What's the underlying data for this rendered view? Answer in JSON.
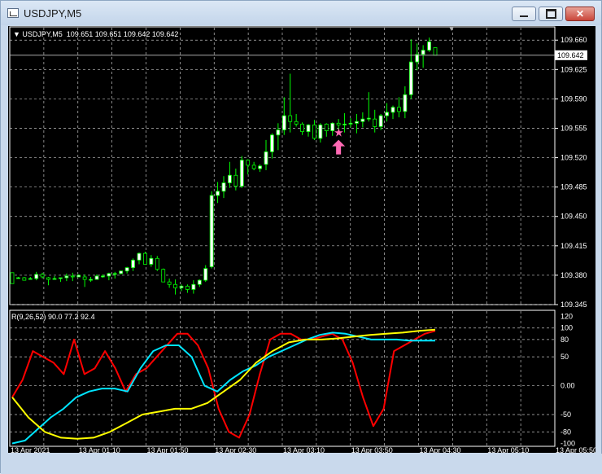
{
  "window": {
    "title": "USDJPY,M5",
    "minimize_icon": "minimize-icon",
    "maximize_icon": "maximize-icon",
    "close_icon": "close-icon"
  },
  "chart": {
    "symbol_header": "USDJPY,M5  109.651 109.651 109.642 109.642",
    "current_price": "109.642",
    "price_ticks": [
      "109.660",
      "109.625",
      "109.590",
      "109.555",
      "109.520",
      "109.485",
      "109.450",
      "109.415",
      "109.380",
      "109.345"
    ],
    "indicator_header": "R(9,26,52) 90.0 77.2 92.4",
    "indicator_ticks": [
      "120",
      "100",
      "80",
      "50",
      "0.00",
      "-50",
      "-80",
      "-100"
    ],
    "time_ticks": [
      "13 Apr 2021",
      "13 Apr 01:10",
      "13 Apr 01:50",
      "13 Apr 02:30",
      "13 Apr 03:10",
      "13 Apr 03:50",
      "13 Apr 04:30",
      "13 Apr 05:10",
      "13 Apr 05:50"
    ],
    "colors": {
      "background": "#000000",
      "grid": "#c0c0c0",
      "candle": "#00ff00",
      "body_fill": "#ffffff",
      "rsi_fast": "#ff0000",
      "rsi_mid": "#00e5ff",
      "rsi_slow": "#ffff00",
      "arrow": "#ff69b4"
    }
  },
  "chart_data": [
    {
      "type": "candlestick",
      "title": "USDJPY,M5",
      "ylim": [
        109.345,
        109.668
      ],
      "ohlc": [
        [
          109.383,
          109.383,
          109.37,
          109.37
        ],
        [
          109.377,
          109.378,
          109.376,
          109.377
        ],
        [
          109.377,
          109.378,
          109.374,
          109.374
        ],
        [
          109.376,
          109.378,
          109.375,
          109.376
        ],
        [
          109.376,
          109.384,
          109.374,
          109.381
        ],
        [
          109.381,
          109.383,
          109.376,
          109.378
        ],
        [
          109.377,
          109.378,
          109.368,
          109.375
        ],
        [
          109.375,
          109.379,
          109.375,
          109.376
        ],
        [
          109.376,
          109.377,
          109.372,
          109.377
        ],
        [
          109.377,
          109.382,
          109.373,
          109.379
        ],
        [
          109.379,
          109.383,
          109.373,
          109.378
        ],
        [
          109.378,
          109.381,
          109.378,
          109.38
        ],
        [
          109.378,
          109.381,
          109.366,
          109.375
        ],
        [
          109.375,
          109.378,
          109.372,
          109.375
        ],
        [
          109.375,
          109.381,
          109.375,
          109.379
        ],
        [
          109.379,
          109.381,
          109.377,
          109.379
        ],
        [
          109.379,
          109.383,
          109.374,
          109.382
        ],
        [
          109.382,
          109.384,
          109.376,
          109.382
        ],
        [
          109.382,
          109.385,
          109.381,
          109.385
        ],
        [
          109.385,
          109.39,
          109.382,
          109.389
        ],
        [
          109.389,
          109.4,
          109.385,
          109.398
        ],
        [
          109.398,
          109.407,
          109.393,
          109.406
        ],
        [
          109.406,
          109.408,
          109.393,
          109.393
        ],
        [
          109.393,
          109.404,
          109.39,
          109.4
        ],
        [
          109.4,
          109.403,
          109.385,
          109.387
        ],
        [
          109.387,
          109.388,
          109.372,
          109.372
        ],
        [
          109.372,
          109.376,
          109.365,
          109.369
        ],
        [
          109.369,
          109.375,
          109.357,
          109.365
        ],
        [
          109.365,
          109.369,
          109.361,
          109.367
        ],
        [
          109.367,
          109.369,
          109.359,
          109.363
        ],
        [
          109.363,
          109.374,
          109.358,
          109.369
        ],
        [
          109.369,
          109.375,
          109.366,
          109.374
        ],
        [
          109.374,
          109.392,
          109.372,
          109.388
        ],
        [
          109.39,
          109.48,
          109.388,
          109.475
        ],
        [
          109.475,
          109.491,
          109.466,
          109.48
        ],
        [
          109.48,
          109.498,
          109.472,
          109.49
        ],
        [
          109.49,
          109.515,
          109.484,
          109.499
        ],
        [
          109.499,
          109.507,
          109.481,
          109.486
        ],
        [
          109.486,
          109.522,
          109.484,
          109.517
        ],
        [
          109.517,
          109.518,
          109.5,
          109.511
        ],
        [
          109.511,
          109.515,
          109.505,
          109.507
        ],
        [
          109.507,
          109.512,
          109.503,
          109.51
        ],
        [
          109.512,
          109.541,
          109.505,
          109.527
        ],
        [
          109.527,
          109.549,
          109.519,
          109.547
        ],
        [
          109.547,
          109.561,
          109.529,
          109.553
        ],
        [
          109.553,
          109.592,
          109.547,
          109.57
        ],
        [
          109.57,
          109.62,
          109.55,
          109.563
        ],
        [
          109.563,
          109.572,
          109.557,
          109.56
        ],
        [
          109.56,
          109.562,
          109.547,
          109.551
        ],
        [
          109.551,
          109.56,
          109.545,
          109.559
        ],
        [
          109.559,
          109.565,
          109.541,
          109.543
        ],
        [
          109.543,
          109.561,
          109.538,
          109.559
        ],
        [
          109.56,
          109.561,
          109.545,
          109.552
        ],
        [
          109.552,
          109.562,
          109.546,
          109.561
        ],
        [
          109.561,
          109.566,
          109.551,
          109.559
        ],
        [
          109.559,
          109.573,
          109.55,
          109.56
        ],
        [
          109.56,
          109.567,
          109.556,
          109.561
        ],
        [
          109.561,
          109.572,
          109.549,
          109.563
        ],
        [
          109.563,
          109.574,
          109.556,
          109.566
        ],
        [
          109.566,
          109.598,
          109.563,
          109.567
        ],
        [
          109.566,
          109.577,
          109.55,
          109.557
        ],
        [
          109.557,
          109.572,
          109.553,
          109.57
        ],
        [
          109.57,
          109.585,
          109.563,
          109.574
        ],
        [
          109.574,
          109.582,
          109.566,
          109.58
        ],
        [
          109.58,
          109.592,
          109.568,
          109.575
        ],
        [
          109.575,
          109.605,
          109.567,
          109.595
        ],
        [
          109.595,
          109.661,
          109.59,
          109.634
        ],
        [
          109.634,
          109.656,
          109.624,
          109.643
        ],
        [
          109.643,
          109.654,
          109.627,
          109.648
        ],
        [
          109.648,
          109.663,
          109.646,
          109.658
        ],
        [
          109.651,
          109.651,
          109.642,
          109.642
        ]
      ],
      "signal_marker": {
        "type": "buy-arrow",
        "index": 54
      }
    },
    {
      "type": "line",
      "title": "R(9,26,52) 90.0 77.2 92.4",
      "ylim": [
        -105,
        125
      ],
      "series": [
        {
          "values": [
            -20,
            10,
            60,
            50,
            40,
            20,
            80,
            20,
            30,
            60,
            30,
            -10,
            20,
            30,
            50,
            70,
            90,
            90,
            70,
            30,
            -40,
            -80,
            -90,
            -50,
            20,
            80,
            90,
            90,
            80,
            80,
            85,
            90,
            80,
            40,
            -20,
            -70,
            -40,
            60,
            70,
            80,
            90,
            95
          ]
        },
        {
          "values": [
            -100,
            -95,
            -75,
            -55,
            -40,
            -20,
            -10,
            -5,
            -5,
            -10,
            30,
            60,
            70,
            70,
            50,
            0,
            -10,
            10,
            25,
            35,
            50,
            60,
            70,
            80,
            88,
            92,
            90,
            85,
            80,
            80,
            80,
            78,
            78,
            78
          ]
        },
        {
          "values": [
            -20,
            -55,
            -80,
            -90,
            -92,
            -90,
            -80,
            -65,
            -50,
            -45,
            -40,
            -40,
            -30,
            -10,
            10,
            40,
            60,
            75,
            80,
            80,
            82,
            85,
            88,
            90,
            92,
            95,
            97
          ]
        }
      ]
    }
  ]
}
